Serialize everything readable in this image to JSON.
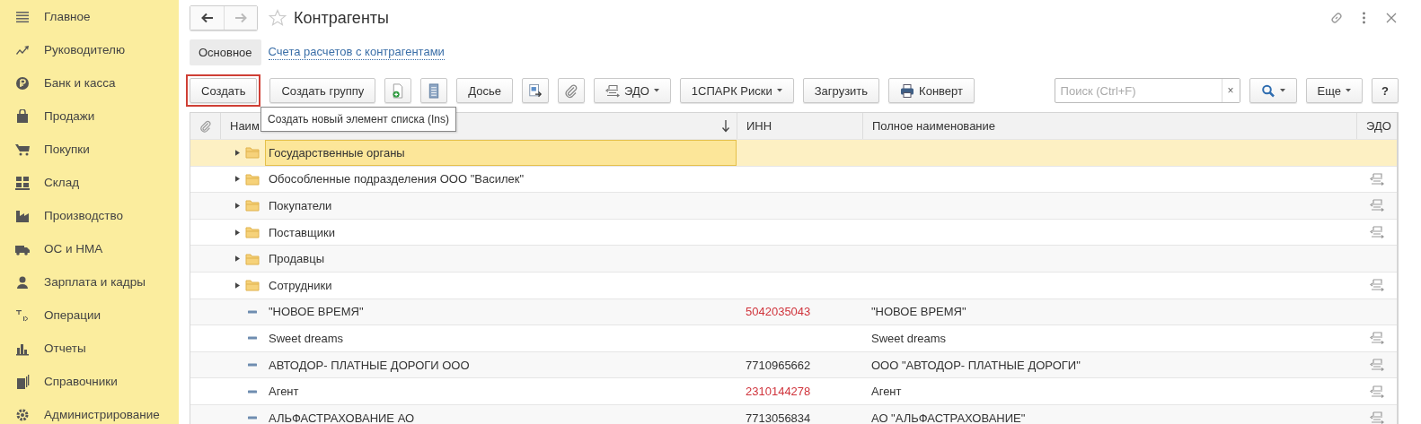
{
  "sidebar": {
    "items": [
      {
        "label": "Главное",
        "selected": false
      },
      {
        "label": "Руководителю",
        "selected": false
      },
      {
        "label": "Банк и касса",
        "selected": false
      },
      {
        "label": "Продажи",
        "selected": false
      },
      {
        "label": "Покупки",
        "selected": false
      },
      {
        "label": "Склад",
        "selected": false
      },
      {
        "label": "Производство",
        "selected": false
      },
      {
        "label": "ОС и НМА",
        "selected": false
      },
      {
        "label": "Зарплата и кадры",
        "selected": false
      },
      {
        "label": "Операции",
        "selected": false
      },
      {
        "label": "Отчеты",
        "selected": false
      },
      {
        "label": "Справочники",
        "selected": false
      },
      {
        "label": "Администрирование",
        "selected": false
      }
    ]
  },
  "window": {
    "title": "Контрагенты"
  },
  "tabs": [
    {
      "label": "Основное",
      "selected": true
    },
    {
      "label": "Счета расчетов с контрагентами",
      "selected": false
    }
  ],
  "toolbar": [
    {
      "kind": "text",
      "label": "Создать",
      "highlighted": true
    },
    {
      "kind": "text",
      "label": "Создать группу",
      "highlighted": false
    },
    {
      "kind": "icon",
      "highlighted": false
    },
    {
      "kind": "icon",
      "highlighted": false
    },
    {
      "kind": "text",
      "label": "Досье",
      "highlighted": false
    },
    {
      "kind": "icon",
      "highlighted": false
    },
    {
      "kind": "icon",
      "highlighted": false
    },
    {
      "kind": "menu",
      "label": "ЭДО",
      "highlighted": false
    },
    {
      "kind": "menu",
      "label": "1СПАРК Риски",
      "highlighted": false
    },
    {
      "kind": "text",
      "label": "Загрузить",
      "highlighted": false
    },
    {
      "kind": "text",
      "label": "Конверт",
      "highlighted": false
    }
  ],
  "search": {
    "placeholder": "Поиск (Ctrl+F)",
    "clear": "×"
  },
  "right_buttons": [
    {
      "kind": "search-menu"
    },
    {
      "kind": "menu",
      "label": "Еще"
    },
    {
      "kind": "text",
      "label": "?"
    }
  ],
  "tooltip": "Создать новый элемент списка (Ins)",
  "table": {
    "columns": [
      "Наим",
      "ИНН",
      "Полное наименование",
      "ЭДО"
    ],
    "rows": [
      {
        "kind": "folder",
        "name": "Государственные органы",
        "selected": true,
        "edo": false
      },
      {
        "kind": "folder",
        "name": "Обособленные подразделения ООО \"Василек\"",
        "selected": false,
        "edo": true
      },
      {
        "kind": "folder",
        "name": "Покупатели",
        "selected": false,
        "edo": true
      },
      {
        "kind": "folder",
        "name": "Поставщики",
        "selected": false,
        "edo": true
      },
      {
        "kind": "folder",
        "name": "Продавцы",
        "selected": false,
        "edo": false
      },
      {
        "kind": "folder",
        "name": "Сотрудники",
        "selected": false,
        "edo": true
      },
      {
        "kind": "item",
        "name": "\"НОВОЕ ВРЕМЯ\"",
        "inn": "5042035043",
        "inn_invalid": true,
        "full_name": "\"НОВОЕ ВРЕМЯ\"",
        "selected": false,
        "edo": false
      },
      {
        "kind": "item",
        "name": "Sweet dreams",
        "full_name": "Sweet dreams",
        "selected": false,
        "edo": true
      },
      {
        "kind": "item",
        "name": "АВТОДОР- ПЛАТНЫЕ ДОРОГИ ООО",
        "inn": "7710965662",
        "inn_invalid": false,
        "full_name": "ООО \"АВТОДОР- ПЛАТНЫЕ ДОРОГИ\"",
        "selected": false,
        "edo": true
      },
      {
        "kind": "item",
        "name": "Агент",
        "inn": "2310144278",
        "inn_invalid": true,
        "full_name": "Агент",
        "selected": false,
        "edo": true
      },
      {
        "kind": "item",
        "name": "АЛЬФАСТРАХОВАНИЕ АО",
        "inn": "7713056834",
        "inn_invalid": false,
        "full_name": "АО \"АЛЬФАСТРАХОВАНИЕ\"",
        "selected": false,
        "edo": true
      }
    ]
  }
}
